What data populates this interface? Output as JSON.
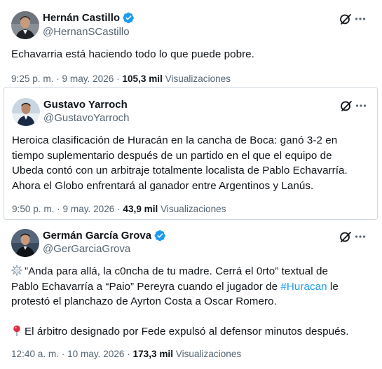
{
  "tweets": [
    {
      "name": "Hernán Castillo",
      "handle": "@HernanSCastillo",
      "verified": true,
      "text_lines": [
        "Echavarria está haciendo todo lo que puede pobre."
      ],
      "time": "9:25 p. m. · 9 may. 2026 · ",
      "views_count": "105,3 mil",
      "views_label": " Visualizaciones"
    },
    {
      "name": "Gustavo Yarroch",
      "handle": "@GustavoYarroch",
      "verified": false,
      "text_lines": [
        "Heroica clasificación de Huracán en la cancha de Boca: ganó 3-2 en",
        "tiempo suplementario después de un partido en el que el equipo de",
        "Ubeda contó con un arbitraje totalmente localista de Pablo Echavarría.",
        "Ahora el Globo enfrentará al ganador entre Argentinos y Lanús."
      ],
      "time": "9:50 p. m. · 9 may. 2026 · ",
      "views_count": "43,9 mil",
      "views_label": " Visualizaciones"
    },
    {
      "name": "Germán García Grova",
      "handle": "@GerGarciaGrova",
      "verified": true,
      "text_lines": [
        "”Anda para allá, la c0ncha de tu madre. Cerrá el 0rto” textual de",
        "Pablo Echavarría a “Paio” Pereyra cuando el jugador de ",
        "protestó el planchazo de Ayrton Costa a Oscar Romero.",
        "El árbitro designado por Fede expulsó al defensor minutos después."
      ],
      "hashtag": "#Huracan",
      "line2_after": " le",
      "time": "12:40 a. m. · 10 may. 2026 · ",
      "views_count": "173,3 mil",
      "views_label": " Visualizaciones"
    }
  ],
  "icons": {
    "verified": "verified-badge-icon",
    "grok": "grok-icon",
    "more": "more-options-icon",
    "collision": "collision-emoji-icon",
    "pin": "round-pushpin-emoji-icon"
  },
  "colors": {
    "text": "#0f1419",
    "secondary": "#536471",
    "accent": "#1d9bf0",
    "border": "#cfd9de"
  }
}
